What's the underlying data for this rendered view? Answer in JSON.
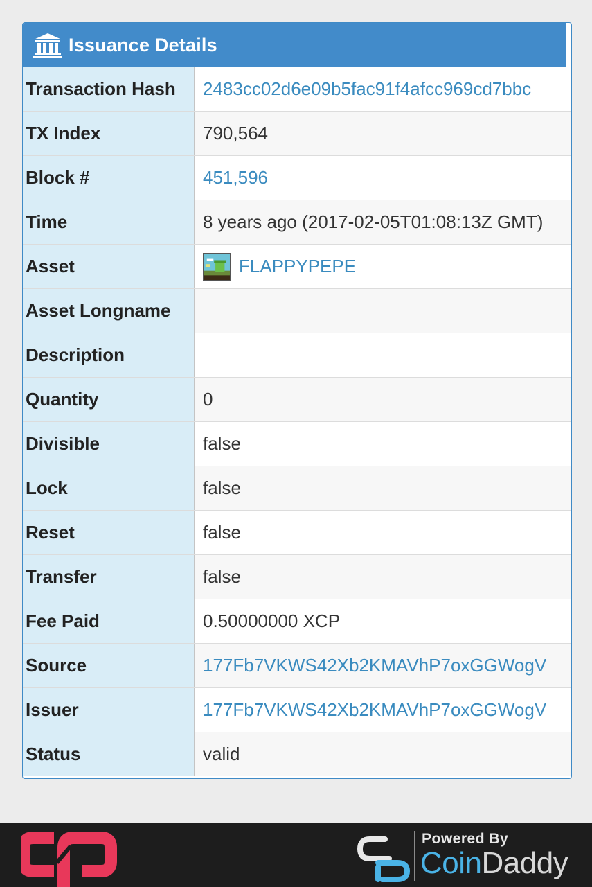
{
  "panel": {
    "title": "Issuance Details",
    "icon": "bank-icon"
  },
  "rows": {
    "tx_hash": {
      "label": "Transaction Hash",
      "value": "2483cc02d6e09b5fac91f4afcc969cd7bbc"
    },
    "tx_index": {
      "label": "TX Index",
      "value": "790,564"
    },
    "block": {
      "label": "Block #",
      "value": "451,596"
    },
    "time": {
      "label": "Time",
      "value": "8 years ago (2017-02-05T01:08:13Z GMT)"
    },
    "asset": {
      "label": "Asset",
      "value": "FLAPPYPEPE",
      "icon": "asset-thumbnail"
    },
    "asset_longname": {
      "label": "Asset Longname",
      "value": ""
    },
    "description": {
      "label": "Description",
      "value": ""
    },
    "quantity": {
      "label": "Quantity",
      "value": "0"
    },
    "divisible": {
      "label": "Divisible",
      "value": "false"
    },
    "lock": {
      "label": "Lock",
      "value": "false"
    },
    "reset": {
      "label": "Reset",
      "value": "false"
    },
    "transfer": {
      "label": "Transfer",
      "value": "false"
    },
    "fee_paid": {
      "label": "Fee Paid",
      "value": "0.50000000 XCP"
    },
    "source": {
      "label": "Source",
      "value": "177Fb7VKWS42Xb2KMAVhP7oxGGWogV"
    },
    "issuer": {
      "label": "Issuer",
      "value": "177Fb7VKWS42Xb2KMAVhP7oxGGWogV"
    },
    "status": {
      "label": "Status",
      "value": "valid"
    }
  },
  "footer": {
    "left_logo": "counterparty-logo",
    "powered_by": "Powered By",
    "brand_coin": "Coin",
    "brand_daddy": "Daddy",
    "brand_icon": "coindaddy-logo-icon"
  },
  "colors": {
    "header_bg": "#428bca",
    "label_bg": "#d9edf7",
    "link": "#3a8bbf",
    "footer_bg": "#1d1d1d",
    "counterparty_red": "#e8385a",
    "coindaddy_blue": "#4ab3e6"
  }
}
